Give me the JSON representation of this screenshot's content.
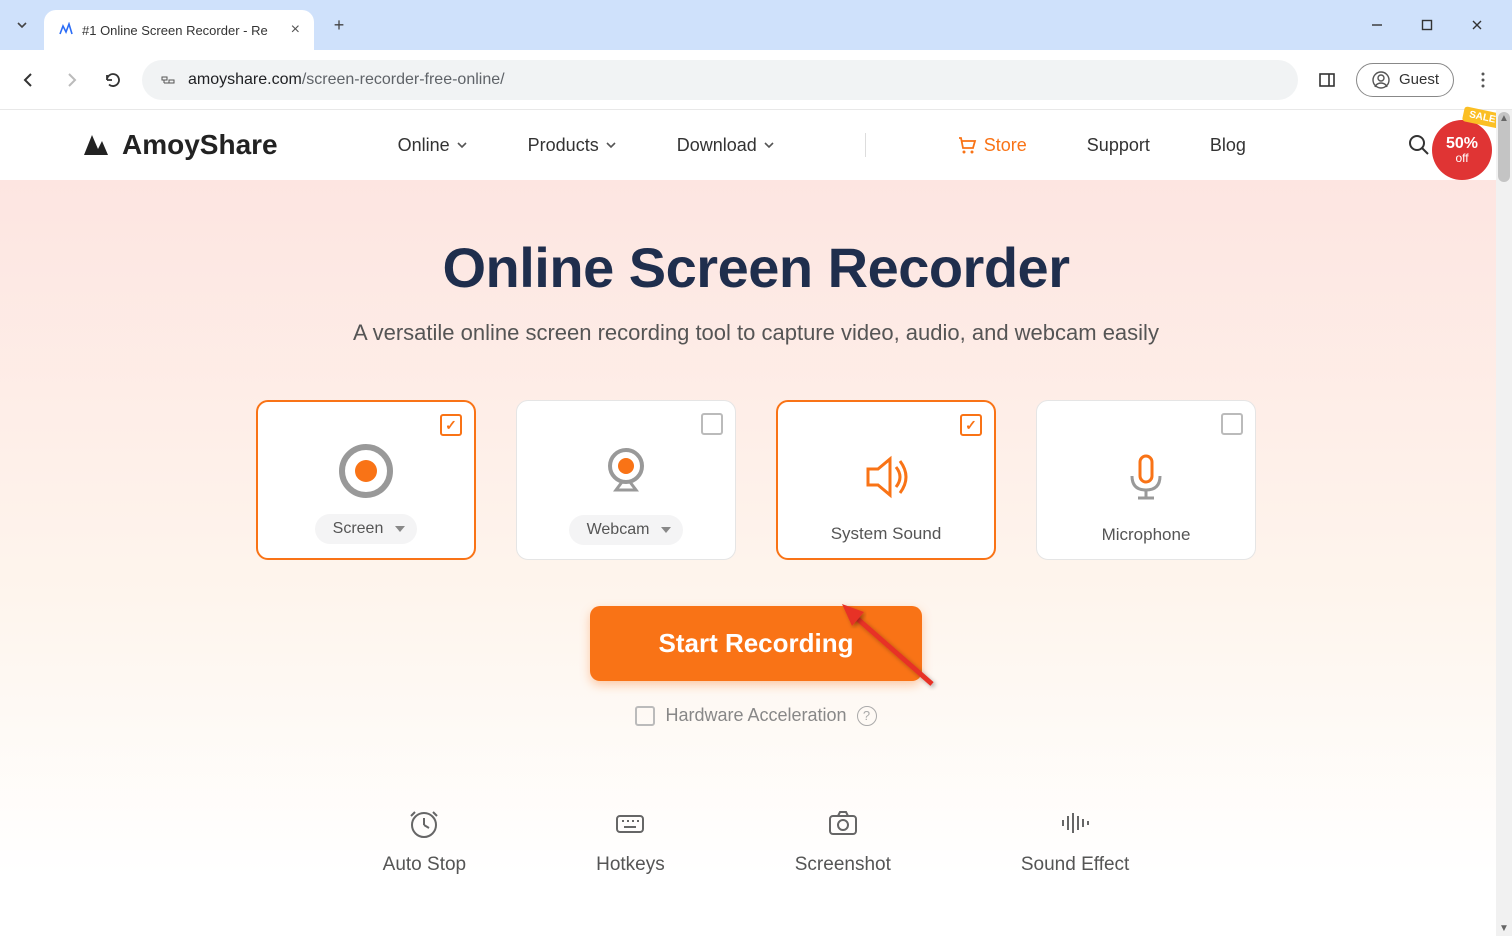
{
  "browser": {
    "tab_title": "#1 Online Screen Recorder - Re",
    "url_domain": "amoyshare.com",
    "url_path": "/screen-recorder-free-online/",
    "guest_label": "Guest"
  },
  "header": {
    "brand": "AmoyShare",
    "nav": {
      "online": "Online",
      "products": "Products",
      "download": "Download",
      "store": "Store",
      "support": "Support",
      "blog": "Blog"
    },
    "sale": {
      "tag": "SALE",
      "percent": "50%",
      "off": "off"
    }
  },
  "hero": {
    "title": "Online Screen Recorder",
    "subtitle": "A versatile online screen recording tool to capture video, audio, and webcam easily"
  },
  "options": {
    "screen": {
      "label": "Screen",
      "selected": true
    },
    "webcam": {
      "label": "Webcam",
      "selected": false
    },
    "system_sound": {
      "label": "System Sound",
      "selected": true
    },
    "microphone": {
      "label": "Microphone",
      "selected": false
    }
  },
  "actions": {
    "start_recording": "Start Recording",
    "hw_accel": "Hardware Acceleration"
  },
  "features": {
    "auto_stop": "Auto Stop",
    "hotkeys": "Hotkeys",
    "screenshot": "Screenshot",
    "sound_effect": "Sound Effect"
  }
}
